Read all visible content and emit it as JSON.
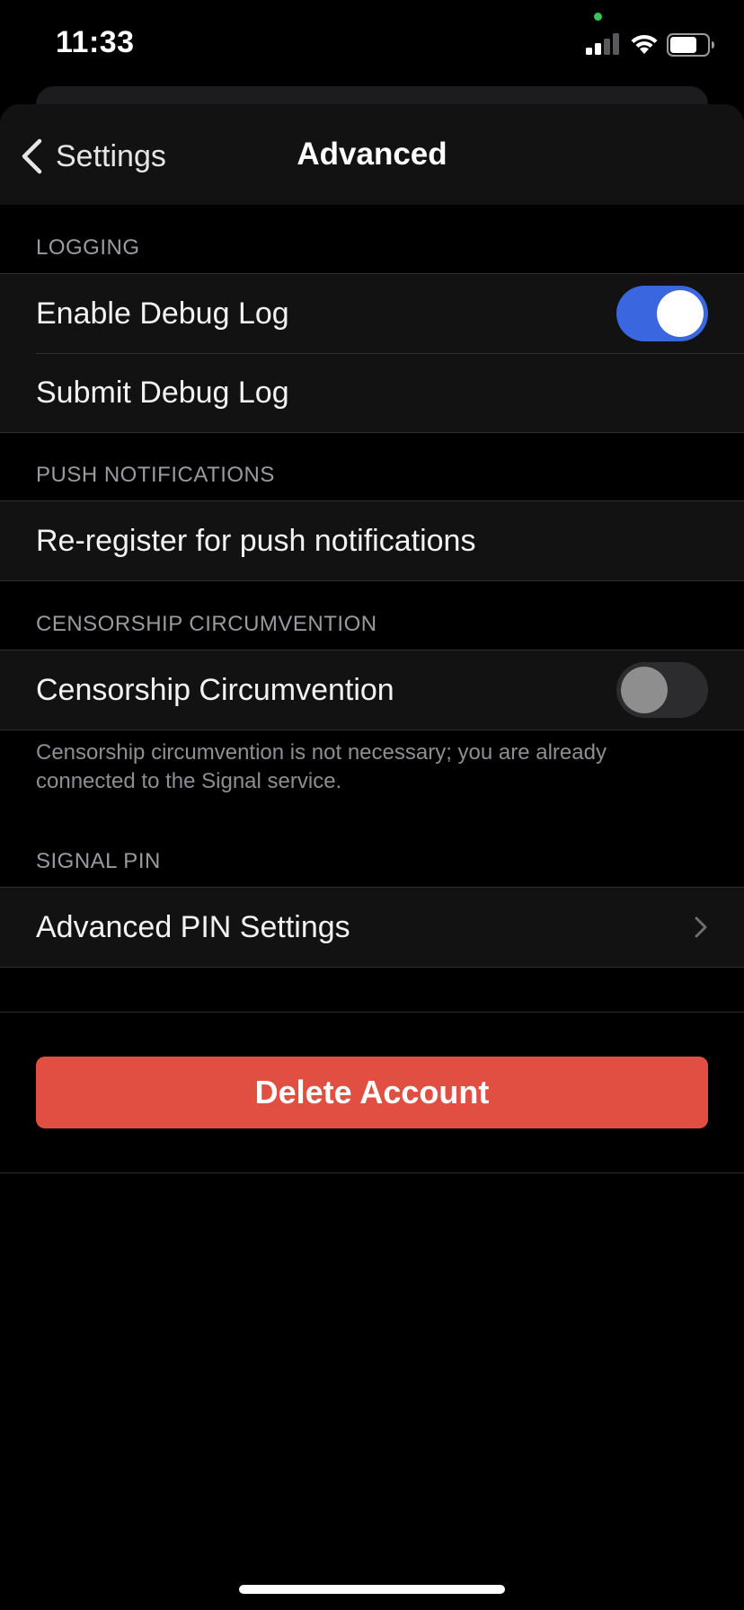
{
  "status_bar": {
    "time": "11:33",
    "privacy_indicator_color": "#34c759",
    "icons": [
      "signal-icon",
      "wifi-icon",
      "battery-icon"
    ]
  },
  "nav": {
    "back_label": "Settings",
    "title": "Advanced",
    "back_icon": "chevron-left-icon"
  },
  "sections": {
    "logging": {
      "header": "LOGGING",
      "enable_debug_log": {
        "label": "Enable Debug Log",
        "enabled": true
      },
      "submit_debug_log": {
        "label": "Submit Debug Log"
      }
    },
    "push": {
      "header": "PUSH NOTIFICATIONS",
      "reregister": {
        "label": "Re-register for push notifications"
      }
    },
    "censorship": {
      "header": "CENSORSHIP CIRCUMVENTION",
      "toggle": {
        "label": "Censorship Circumvention",
        "enabled": false
      },
      "footer": "Censorship circumvention is not necessary; you are already connected to the Signal service."
    },
    "pin": {
      "header": "SIGNAL PIN",
      "advanced_pin": {
        "label": "Advanced PIN Settings",
        "icon": "chevron-right-icon"
      }
    }
  },
  "delete_account": {
    "label": "Delete Account",
    "color": "#e04f42"
  },
  "colors": {
    "accent": "#3a66e0",
    "background": "#000000",
    "cell": "#121212"
  }
}
